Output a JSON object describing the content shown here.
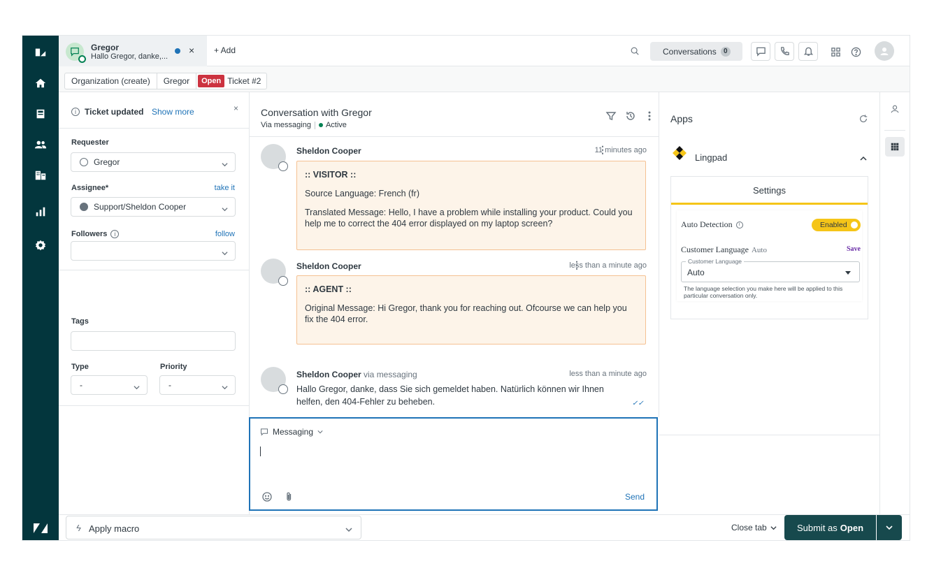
{
  "colors": {
    "rail": "#03363d",
    "accent": "#1f73b7",
    "open_status": "#cc3340",
    "note_bg": "#fdf4e9",
    "lingpad_yellow": "#f5c518",
    "submit": "#17494d"
  },
  "nav": {
    "icons": [
      "logo-icon",
      "home-icon",
      "views-icon",
      "customers-icon",
      "organizations-icon",
      "reporting-icon",
      "admin-icon"
    ]
  },
  "top": {
    "tab": {
      "title": "Gregor",
      "preview": "Hallo Gregor, danke,...",
      "close": "×"
    },
    "add_label": "+ Add",
    "conversations_label": "Conversations",
    "conversations_count": "0"
  },
  "breadcrumb": {
    "organization": "Organization (create)",
    "requester": "Gregor",
    "status": "Open",
    "ticket": "Ticket #2"
  },
  "props": {
    "notice_title": "Ticket updated",
    "notice_link": "Show more",
    "notice_close": "×",
    "requester_label": "Requester",
    "requester_value": "Gregor",
    "assignee_label": "Assignee*",
    "assignee_link": "take it",
    "assignee_value": "Support/Sheldon Cooper",
    "followers_label": "Followers",
    "followers_link": "follow",
    "tags_label": "Tags",
    "type_label": "Type",
    "type_value": "-",
    "priority_label": "Priority",
    "priority_value": "-"
  },
  "conversation": {
    "title": "Conversation with Gregor",
    "channel": "Via messaging",
    "state": "Active",
    "messages": [
      {
        "author": "Sheldon Cooper",
        "time": "11 minutes ago",
        "lines": [
          ":: VISITOR ::",
          "Source Language: French (fr)",
          "Translated Message: Hello, I have a problem while installing your product. Could you help me to correct the 404 error displayed on my laptop screen?"
        ]
      },
      {
        "author": "Sheldon Cooper",
        "time": "less than a minute ago",
        "lines": [
          ":: AGENT ::",
          "Original Message: Hi Gregor, thank you for reaching out. Ofcourse we can help you fix the 404 error."
        ]
      },
      {
        "author": "Sheldon Cooper",
        "via": "via messaging",
        "time": "less than a minute ago",
        "text": "Hallo Gregor, danke, dass Sie sich gemeldet haben. Natürlich können wir Ihnen helfen, den 404-Fehler zu beheben.",
        "read_mark": "✓✓"
      }
    ]
  },
  "composer": {
    "channel": "Messaging",
    "send_label": "Send"
  },
  "apps": {
    "title": "Apps",
    "app_name": "Lingpad",
    "settings_label": "Settings",
    "auto_detection_label": "Auto Detection",
    "auto_detection_state": "Enabled",
    "customer_language_label": "Customer Language",
    "customer_language_current": "Auto",
    "save_label": "Save",
    "select_legend": "Customer Language",
    "select_value": "Auto",
    "help_text": "The language selection you make here will be applied to this particular conversation only."
  },
  "footer": {
    "macro_label": "Apply macro",
    "close_tab_label": "Close tab",
    "submit_prefix": "Submit as",
    "submit_status": "Open"
  }
}
